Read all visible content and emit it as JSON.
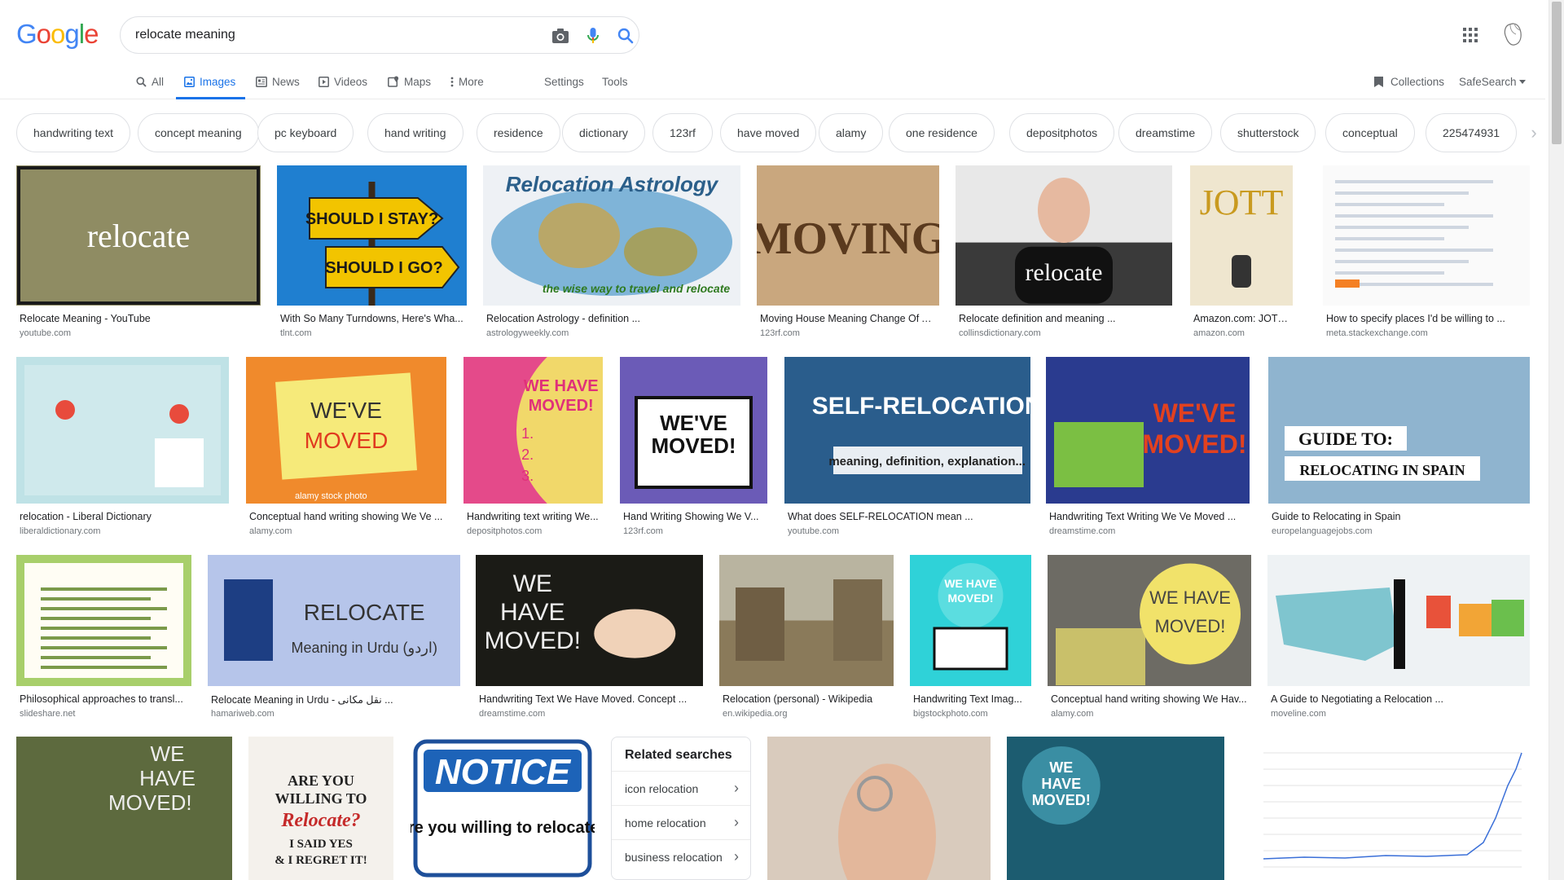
{
  "logo": {
    "letters": [
      "G",
      "o",
      "o",
      "g",
      "l",
      "e"
    ],
    "colors": [
      "#4285f4",
      "#ea4335",
      "#fbbc05",
      "#4285f4",
      "#34a853",
      "#ea4335"
    ]
  },
  "search": {
    "query": "relocate meaning"
  },
  "tabs": [
    {
      "label": "All",
      "icon": "search-icon",
      "active": false
    },
    {
      "label": "Images",
      "icon": "image-icon",
      "active": true
    },
    {
      "label": "News",
      "icon": "news-icon",
      "active": false
    },
    {
      "label": "Videos",
      "icon": "video-icon",
      "active": false
    },
    {
      "label": "Maps",
      "icon": "map-icon",
      "active": false
    },
    {
      "label": "More",
      "icon": "more-vert-icon",
      "active": false
    }
  ],
  "tools": {
    "settings": "Settings",
    "tools": "Tools",
    "collections": "Collections",
    "safesearch": "SafeSearch"
  },
  "chips": [
    "handwriting text",
    "concept meaning",
    "pc keyboard",
    "hand writing",
    "residence",
    "dictionary",
    "123rf",
    "have moved",
    "alamy",
    "one residence",
    "depositphotos",
    "dreamstime",
    "shutterstock",
    "conceptual",
    "225474931"
  ],
  "results": [
    {
      "caption": "Relocate Meaning - YouTube",
      "source": "youtube.com",
      "text": "relocate",
      "bg": "#8f8c63"
    },
    {
      "caption": "With So Many Turndowns, Here's Wha...",
      "source": "tlnt.com",
      "text": "SHOULD I STAY? SHOULD I GO?",
      "bg": "#1f7fd0"
    },
    {
      "caption": "Relocation Astrology - definition ...",
      "source": "astrologyweekly.com",
      "text": "Relocation Astrology",
      "subtext": "the wise way to travel and relocate",
      "bg": "#eef1f5"
    },
    {
      "caption": "Moving House Meaning Change Of A...",
      "source": "123rf.com",
      "text": "MOVING",
      "bg": "#c9a77e"
    },
    {
      "caption": "Relocate definition and meaning ...",
      "source": "collinsdictionary.com",
      "text": "relocate",
      "bg": "#e8e8e8"
    },
    {
      "caption": "Amazon.com: JOTT: w...",
      "source": "amazon.com",
      "text": "JOTT",
      "bg": "#efe6cf"
    },
    {
      "caption": "How to specify places I'd be willing to ...",
      "source": "meta.stackexchange.com",
      "text": "",
      "bg": "#fafafa"
    },
    {
      "caption": "relocation - Liberal Dictionary",
      "source": "liberaldictionary.com",
      "text": "",
      "bg": "#bfe2e6"
    },
    {
      "caption": "Conceptual hand writing showing We Ve ...",
      "source": "alamy.com",
      "text": "WE'VE MOVED",
      "subtext": "alamy stock photo",
      "bg": "#f08a2c"
    },
    {
      "caption": "Handwriting text writing We...",
      "source": "depositphotos.com",
      "text": "WE HAVE MOVED!",
      "bg": "#e44a8a"
    },
    {
      "caption": "Hand Writing Showing We V...",
      "source": "123rf.com",
      "text": "WE'VE MOVED!",
      "bg": "#6b5bb7"
    },
    {
      "caption": "What does SELF-RELOCATION mean ...",
      "source": "youtube.com",
      "text": "SELF-RELOCATION",
      "subtext": "meaning, definition, explanation...",
      "bg": "#1d3a5c"
    },
    {
      "caption": "Handwriting Text Writing We Ve Moved ...",
      "source": "dreamstime.com",
      "text": "WE'VE MOVED!",
      "bg": "#2a3b8f"
    },
    {
      "caption": "Guide to Relocating in Spain",
      "source": "europelanguagejobs.com",
      "text": "GUIDE TO:",
      "subtext": "RELOCATING IN SPAIN",
      "bg": "#8fb4cf"
    },
    {
      "caption": "Philosophical approaches to transl...",
      "source": "slideshare.net",
      "text": "",
      "bg": "#a8cf6b"
    },
    {
      "caption": "Relocate Meaning in Urdu - نقل مکانی ...",
      "source": "hamariweb.com",
      "text": "RELOCATE",
      "subtext": "Meaning in Urdu (اردو)",
      "bg": "#b6c5ea"
    },
    {
      "caption": "Handwriting Text We Have Moved. Concept ...",
      "source": "dreamstime.com",
      "text": "WE HAVE MOVED!",
      "bg": "#1b1b16"
    },
    {
      "caption": "Relocation (personal) - Wikipedia",
      "source": "en.wikipedia.org",
      "text": "",
      "bg": "#8a7a5a"
    },
    {
      "caption": "Handwriting Text Imag...",
      "source": "bigstockphoto.com",
      "text": "WE HAVE MOVED!",
      "bg": "#2fd2d8"
    },
    {
      "caption": "Conceptual hand writing showing We Hav...",
      "source": "alamy.com",
      "text": "WE HAVE MOVED!",
      "bg": "#6d6b64"
    },
    {
      "caption": "A Guide to Negotiating a Relocation ...",
      "source": "moveline.com",
      "text": "",
      "bg": "#eef2f4"
    },
    {
      "caption": "",
      "source": "",
      "text": "WE HAVE MOVED!",
      "bg": "#5d6a3e"
    },
    {
      "caption": "",
      "source": "",
      "text": "ARE YOU WILLING TO Relocate? I SAID YES & I REGRET IT!",
      "bg": "#f4f1ec"
    },
    {
      "caption": "",
      "source": "",
      "text": "NOTICE",
      "subtext": "Are you willing to relocate?",
      "bg": "#ffffff"
    },
    {
      "caption": "",
      "source": "",
      "text": "",
      "bg": "#d9cbbd"
    },
    {
      "caption": "",
      "source": "",
      "text": "WE HAVE MOVED!",
      "bg": "#1c5c70"
    },
    {
      "caption": "",
      "source": "",
      "text": "",
      "bg": "#ffffff"
    }
  ],
  "related": {
    "title": "Related searches",
    "items": [
      "icon relocation",
      "home relocation",
      "business relocation"
    ]
  }
}
